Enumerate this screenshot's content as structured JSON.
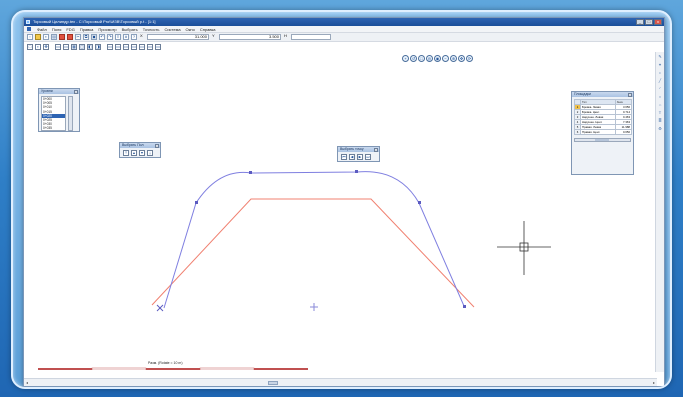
{
  "window": {
    "title": "Торсовый Цилиндр.teх - C:\\Торсовый Pro\\\\ИЗВ\\Торсовый p.t - [1:1]",
    "min": "_",
    "max": "□",
    "close": "x"
  },
  "menu": [
    "Файл",
    "Поля",
    "FDG",
    "Правка",
    "Просмотр",
    "Выбрать",
    "Точность",
    "Система",
    "Окно",
    "Справка"
  ],
  "coords": {
    "x_label": "X",
    "x_value": "31.000",
    "y_label": "Y",
    "y_value": "3.500",
    "h_label": "H"
  },
  "layers_panel": {
    "title": "Уровни",
    "rows": [
      "0+000",
      "0+005",
      "0+010",
      "0+015",
      "0+020",
      "0+025",
      "0+030",
      "0+035"
    ],
    "selected_index": 4
  },
  "float1": {
    "title": "Выбрать Пол"
  },
  "float2": {
    "title": "Выбрать точку"
  },
  "points_panel": {
    "title": "Площадки",
    "headers": [
      "",
      "Тип",
      "Знач"
    ],
    "rows": [
      {
        "n": "1",
        "name": "Бровка. Левая",
        "val": "3.650"
      },
      {
        "n": "2",
        "name": "Бровка. Цент.",
        "val": "0.714"
      },
      {
        "n": "3",
        "name": "Нарушен. Левая",
        "val": "0.463"
      },
      {
        "n": "4",
        "name": "Нарушен. Цент.",
        "val": "7.363"
      },
      {
        "n": "5",
        "name": "Правая. Левая",
        "val": "11.988"
      },
      {
        "n": "6",
        "name": "Правая. Цент.",
        "val": "0.650"
      }
    ],
    "selected_index": 0
  },
  "status": {
    "scale_label": "Разм. (Rotate = 10 m)"
  },
  "icons": {
    "accent": "#2e64b3",
    "profile_blue": "#7f7fe0",
    "profile_red": "#f08070"
  }
}
